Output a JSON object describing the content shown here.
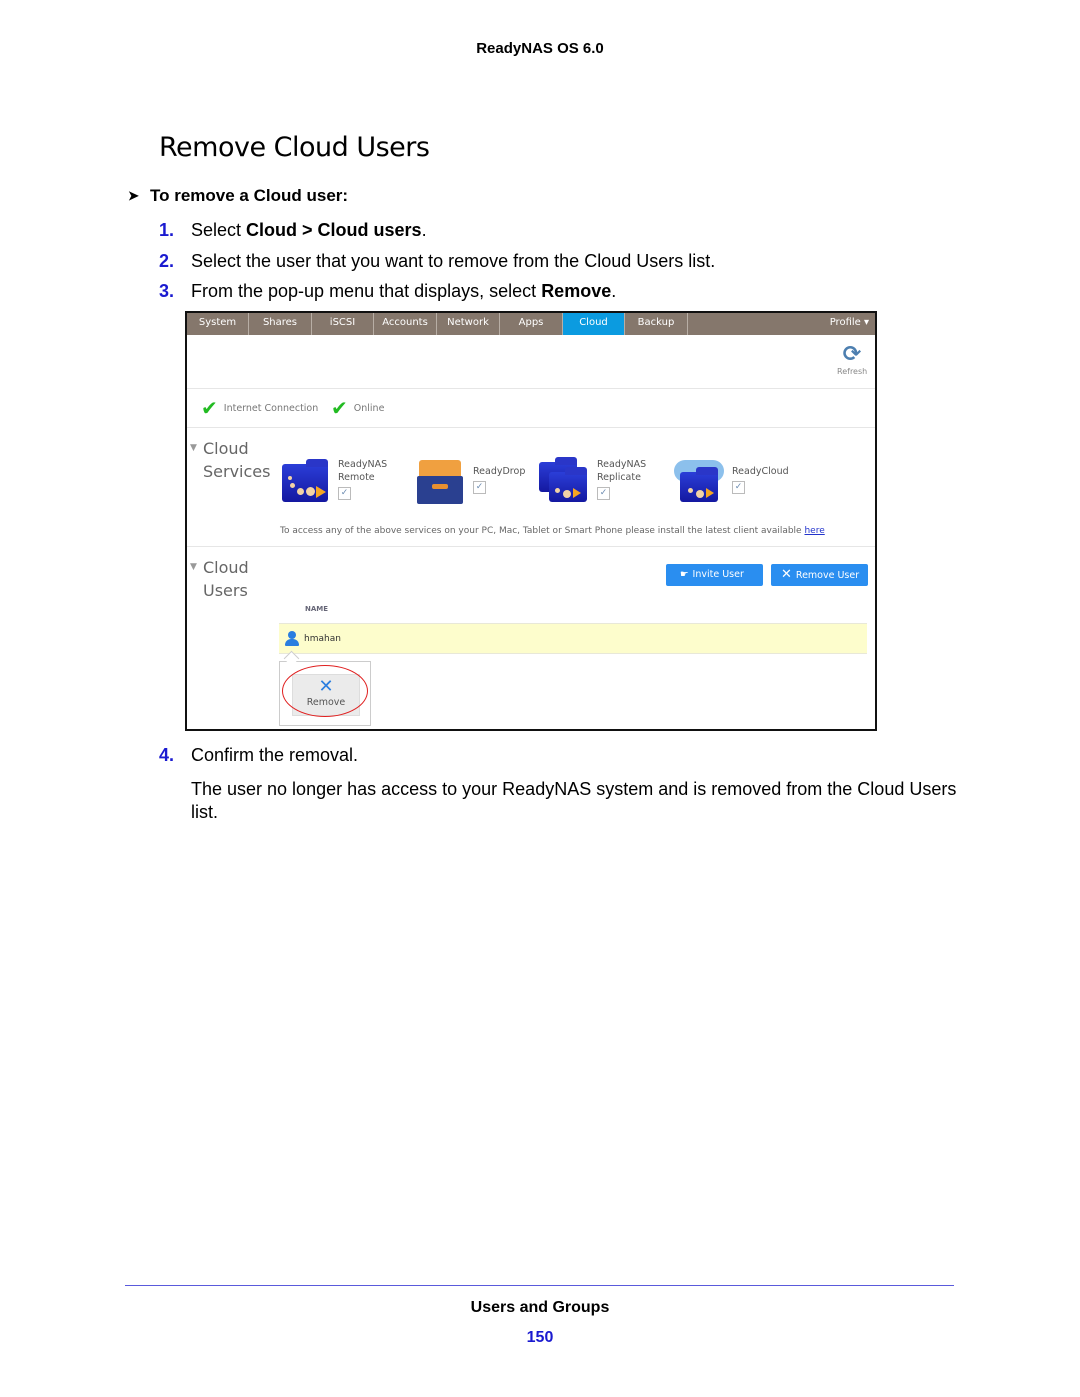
{
  "header": {
    "running_title": "ReadyNAS OS 6.0"
  },
  "page": {
    "title": "Remove Cloud Users"
  },
  "procedure": {
    "heading": "To remove a Cloud user:",
    "steps": [
      {
        "num": "1.",
        "pre": "Select ",
        "bold1": "Cloud",
        "mid": " > ",
        "bold2": "Cloud users",
        "post": "."
      },
      {
        "num": "2.",
        "text": "Select the user that you want to remove from the Cloud Users list."
      },
      {
        "num": "3.",
        "pre": "From the pop-up menu that displays, select ",
        "bold": "Remove",
        "post": "."
      },
      {
        "num": "4.",
        "text": "Confirm the removal."
      }
    ],
    "result": "The user no longer has access to your ReadyNAS system and is removed from the Cloud Users list."
  },
  "screenshot": {
    "nav_tabs": [
      "System",
      "Shares",
      "iSCSI",
      "Accounts",
      "Network",
      "Apps",
      "Cloud",
      "Backup"
    ],
    "active_tab": "Cloud",
    "profile": "Profile ▾",
    "refresh_label": "Refresh",
    "status": [
      {
        "label": "Internet Connection",
        "icon": "check-icon"
      },
      {
        "label": "Online",
        "icon": "check-icon"
      }
    ],
    "services_section": {
      "line1": "Cloud",
      "line2": "Services"
    },
    "services": [
      {
        "line1": "ReadyNAS",
        "line2": "Remote",
        "checked": true
      },
      {
        "line1": "ReadyDrop",
        "line2": "",
        "checked": true
      },
      {
        "line1": "ReadyNAS",
        "line2": "Replicate",
        "checked": true
      },
      {
        "line1": "ReadyCloud",
        "line2": "",
        "checked": true
      }
    ],
    "services_note": "To access any of the above services on your PC, Mac, Tablet or Smart Phone please install the latest client available ",
    "services_note_link": "here",
    "users_section": {
      "line1": "Cloud",
      "line2": "Users"
    },
    "invite_button": "Invite User",
    "remove_user_button": "Remove User",
    "column_header": "NAME",
    "users": [
      {
        "name": "hmahan"
      }
    ],
    "popup_remove": "Remove",
    "colors": {
      "navbar": "#85776c",
      "active_tab": "#0b9be0",
      "button": "#2a8ef0",
      "selected_row": "#fdfdcc",
      "highlight_circle": "#e02020"
    }
  },
  "footer": {
    "section": "Users and Groups",
    "page_number": "150"
  }
}
